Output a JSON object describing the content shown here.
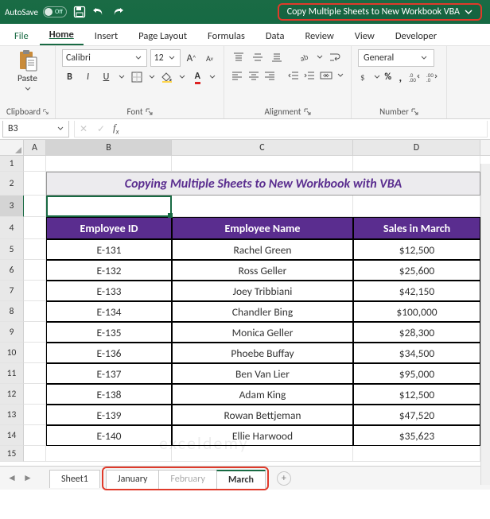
{
  "titlebar": {
    "autosave_label": "AutoSave",
    "autosave_state": "Off",
    "filename": "Copy Multiple Sheets to New Workbook VBA"
  },
  "menu": {
    "tabs": [
      "File",
      "Home",
      "Insert",
      "Page Layout",
      "Formulas",
      "Data",
      "Review",
      "View",
      "Developer"
    ],
    "active": "Home"
  },
  "ribbon": {
    "clipboard_label": "Clipboard",
    "paste_label": "Paste",
    "font_label": "Font",
    "font_name": "Calibri",
    "font_size": "12",
    "alignment_label": "Alignment",
    "number_label": "Number",
    "number_format": "General"
  },
  "namebox": {
    "ref": "B3"
  },
  "grid": {
    "columns": [
      "A",
      "B",
      "C",
      "D"
    ],
    "title": "Copying Multiple Sheets to New Workbook with VBA",
    "headers": [
      "Employee ID",
      "Employee Name",
      "Sales in March"
    ],
    "rows": [
      {
        "id": "E-131",
        "name": "Rachel Green",
        "sales": "$12,500"
      },
      {
        "id": "E-132",
        "name": "Ross Geller",
        "sales": "$25,600"
      },
      {
        "id": "E-133",
        "name": "Joey Tribbiani",
        "sales": "$42,150"
      },
      {
        "id": "E-134",
        "name": "Chandler Bing",
        "sales": "$100,000"
      },
      {
        "id": "E-135",
        "name": "Monica Geller",
        "sales": "$28,300"
      },
      {
        "id": "E-136",
        "name": "Phoebe Buffay",
        "sales": "$34,500"
      },
      {
        "id": "E-137",
        "name": "Ben Van Lier",
        "sales": "$95,000"
      },
      {
        "id": "E-138",
        "name": "Adam King",
        "sales": "$12,500"
      },
      {
        "id": "E-139",
        "name": "Rowan Bettjeman",
        "sales": "$47,520"
      },
      {
        "id": "E-140",
        "name": "Ellie Harwood",
        "sales": "$35,623"
      }
    ],
    "row_labels": [
      "1",
      "2",
      "3",
      "4",
      "5",
      "6",
      "7",
      "8",
      "9",
      "10",
      "11",
      "12",
      "13",
      "14",
      "15"
    ]
  },
  "sheets": {
    "plain": [
      "Sheet1"
    ],
    "highlighted": [
      "January",
      "February",
      "March"
    ],
    "active": "March"
  },
  "watermark": "exceldemy"
}
